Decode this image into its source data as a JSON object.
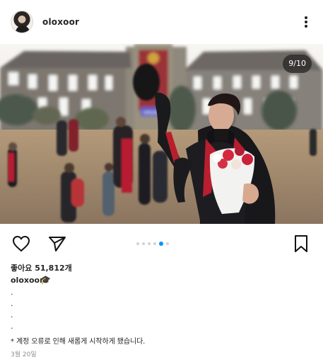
{
  "post": {
    "username": "oloxoor",
    "counter": "9/10",
    "likes": "좋아요 51,812개",
    "caption_user": "oloxoor",
    "caption_emoji": "🎓",
    "caption_lines": [
      ".",
      ".",
      ".",
      "."
    ],
    "caption_note": "* 계정 오류로 인해 새롭게 시작하게 됐습니다.",
    "date": "3월 20일",
    "carousel": {
      "total": 10,
      "current": 9
    }
  },
  "media_text": {
    "banner_label": "ORIGINAL"
  },
  "icons": {
    "more": "more-vertical-icon",
    "like": "heart-icon",
    "share": "send-icon",
    "save": "bookmark-icon"
  },
  "colors": {
    "accent": "#0095f6",
    "text": "#262626",
    "muted": "#8e8e8e"
  }
}
